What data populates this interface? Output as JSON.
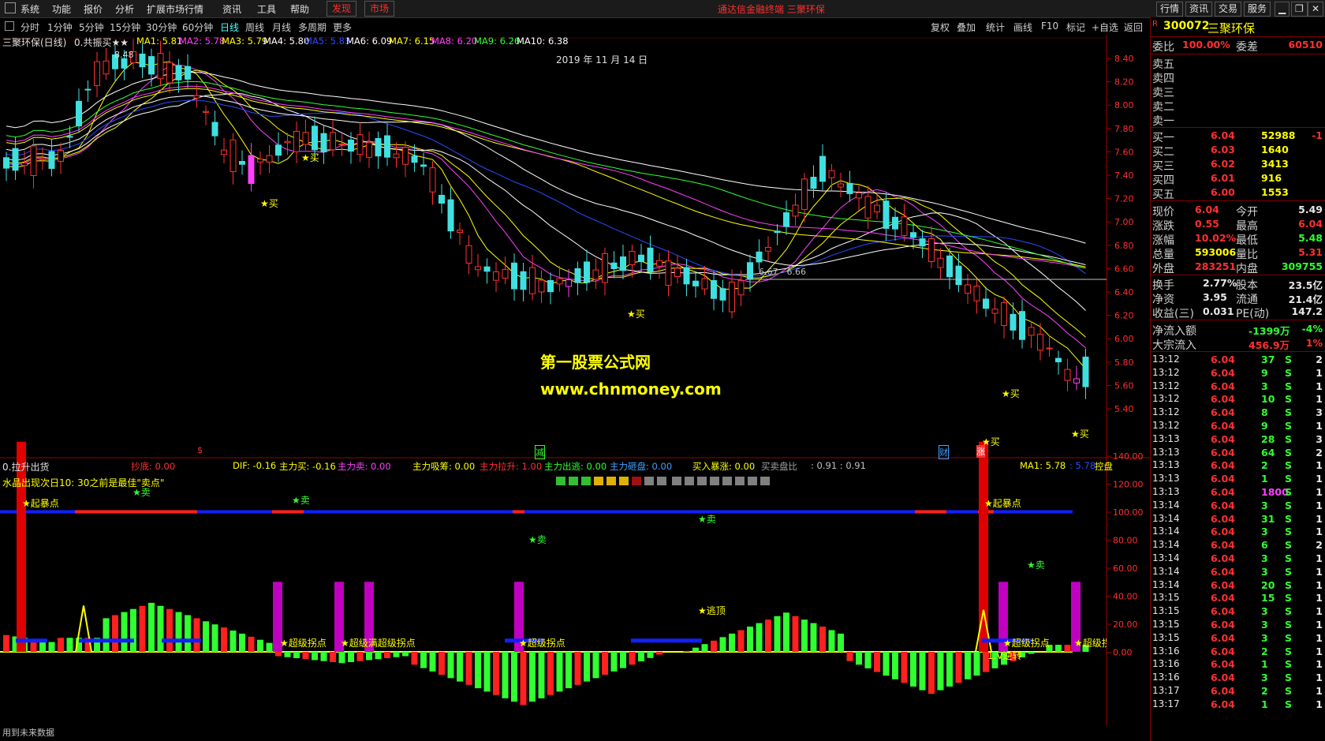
{
  "menu": {
    "items": [
      "系统",
      "功能",
      "报价",
      "分析",
      "扩展市场行情",
      "资讯",
      "工具",
      "帮助"
    ],
    "highlight1": "发现",
    "highlight2": "市场",
    "app_title": "通达信金融终端  三聚环保",
    "right_buttons": [
      "行情",
      "资讯",
      "交易",
      "服务"
    ]
  },
  "periods": {
    "items": [
      "分时",
      "1分钟",
      "5分钟",
      "15分钟",
      "30分钟",
      "60分钟",
      "日线",
      "周线",
      "月线",
      "多周期",
      "更多"
    ],
    "active": "日线"
  },
  "toolbar": {
    "buttons": [
      "复权",
      "叠加",
      "统计",
      "画线",
      "F10",
      "标记",
      "+自选",
      "返回"
    ]
  },
  "upper_chart": {
    "title": "三聚环保(日线)",
    "indicator": "0.共振买★★",
    "ma": [
      {
        "label": "MA1: 5.81",
        "color": "#ffff00"
      },
      {
        "label": "MA2: 5.78",
        "color": "#ff40ff"
      },
      {
        "label": "MA3: 5.79",
        "color": "#ffff00"
      },
      {
        "label": "MA4: 5.80",
        "color": "#ffffff"
      },
      {
        "label": "MA5: 5.83",
        "color": "#2a4bff"
      },
      {
        "label": "MA6: 6.09",
        "color": "#ffffff"
      },
      {
        "label": "MA7: 6.15",
        "color": "#ffff00"
      },
      {
        "label": "MA8: 6.20",
        "color": "#ff40ff"
      },
      {
        "label": "MA9: 6.26",
        "color": "#30ff30"
      },
      {
        "label": "MA10: 6.38",
        "color": "#ffffff"
      }
    ],
    "date_label": "2019 年 11 月 14 日",
    "high_label": "8.48",
    "ref_label": "6.67 - 6.66",
    "y_ticks": [
      "8.40",
      "8.20",
      "8.00",
      "7.80",
      "7.60",
      "7.40",
      "7.20",
      "7.00",
      "6.80",
      "6.60",
      "6.40",
      "6.20",
      "6.00",
      "5.80",
      "5.60",
      "5.40"
    ],
    "buy_marks": [
      "★买",
      "★买",
      "★买",
      "★买",
      "★买",
      "★买"
    ],
    "watermark1": "第一股票公式网",
    "watermark2": "www.chnmoney.com",
    "event_marks": [
      "$",
      "减",
      "财",
      "涨"
    ]
  },
  "lower_chart": {
    "title": "0.拉升出货",
    "stats": [
      {
        "label": "抄底: 0.00",
        "color": "#ff3030"
      },
      {
        "label": "DIF: -0.16",
        "color": "#ffff00"
      },
      {
        "label": "主力买: -0.16",
        "color": "#ffff00"
      },
      {
        "label": "主力卖: 0.00",
        "color": "#ff40ff"
      },
      {
        "label": "主力吸筹: 0.00",
        "color": "#ffff00"
      },
      {
        "label": "主力拉升: 1.00",
        "color": "#ff3030"
      },
      {
        "label": "主力出逃: 0.00",
        "color": "#30ff30"
      },
      {
        "label": "主力砸盘: 0.00",
        "color": "#40a0ff"
      },
      {
        "label": "买入暴涨: 0.00",
        "color": "#ffff00"
      },
      {
        "label": "买卖盘比",
        "color": "#a0a0a0"
      },
      {
        "label": ": 0.91  : 0.91",
        "color": "#c0c0c0"
      },
      {
        "label": "MA1: 5.78",
        "color": "#ffff00"
      },
      {
        "label": ": 5.78",
        "color": "#2a4bff"
      },
      {
        "label": "控盘",
        "color": "#ffff00"
      }
    ],
    "subtitle": "水晶出现次日10: 30之前是最佳\"卖点\"",
    "y_ticks": [
      "140.00",
      "120.00",
      "100.00",
      "80.00",
      "60.00",
      "40.00",
      "20.00",
      "0.00"
    ],
    "labels": {
      "qibao": "★起暴点",
      "sell": "★卖",
      "chaoji": "★超级拐点",
      "chaoji_combo": "★超级满超级拐点",
      "escape": "★逃顶",
      "reverse": "1.V逆转"
    }
  },
  "right_panel": {
    "stock_code": "300072",
    "stock_name": "三聚环保",
    "badge": "R\n300",
    "weibi_label": "委比",
    "weibi_value": "100.00%",
    "weicha_label": "委差",
    "weicha_value": "60510",
    "sell_labels": [
      "卖五",
      "卖四",
      "卖三",
      "卖二",
      "卖一"
    ],
    "buy_book": [
      {
        "label": "买一",
        "price": "6.04",
        "vol": "52988",
        "chg": "-1"
      },
      {
        "label": "买二",
        "price": "6.03",
        "vol": "1640",
        "chg": ""
      },
      {
        "label": "买三",
        "price": "6.02",
        "vol": "3413",
        "chg": ""
      },
      {
        "label": "买四",
        "price": "6.01",
        "vol": "916",
        "chg": ""
      },
      {
        "label": "买五",
        "price": "6.00",
        "vol": "1553",
        "chg": ""
      }
    ],
    "quote": [
      {
        "l1": "现价",
        "v1": "6.04",
        "c1": "red",
        "l2": "今开",
        "v2": "5.49",
        "c2": "wht"
      },
      {
        "l1": "涨跌",
        "v1": "0.55",
        "c1": "red",
        "l2": "最高",
        "v2": "6.04",
        "c2": "red"
      },
      {
        "l1": "涨幅",
        "v1": "10.02%",
        "c1": "red",
        "l2": "最低",
        "v2": "5.48",
        "c2": "grn"
      },
      {
        "l1": "总量",
        "v1": "593006",
        "c1": "yel",
        "l2": "量比",
        "v2": "5.31",
        "c2": "red"
      },
      {
        "l1": "外盘",
        "v1": "283251",
        "c1": "red",
        "l2": "内盘",
        "v2": "309755",
        "c2": "grn"
      }
    ],
    "fundamentals": [
      {
        "l1": "换手",
        "v1": "2.77%",
        "l2": "股本",
        "v2": "23.5亿"
      },
      {
        "l1": "净资",
        "v1": "3.95",
        "l2": "流通",
        "v2": "21.4亿"
      },
      {
        "l1": "收益(三)",
        "v1": "0.031",
        "l2": "PE(动)",
        "v2": "147.2"
      }
    ],
    "flows": [
      {
        "label": "净流入额",
        "value": "-1399万",
        "pct": "-4%",
        "color": "grn"
      },
      {
        "label": "大宗流入",
        "value": "456.9万",
        "pct": "1%",
        "color": "red"
      }
    ],
    "ticks": [
      {
        "t": "13:12",
        "p": "6.04",
        "v": "37",
        "s": "S",
        "n": "2"
      },
      {
        "t": "13:12",
        "p": "6.04",
        "v": "9",
        "s": "S",
        "n": "1"
      },
      {
        "t": "13:12",
        "p": "6.04",
        "v": "3",
        "s": "S",
        "n": "1"
      },
      {
        "t": "13:12",
        "p": "6.04",
        "v": "10",
        "s": "S",
        "n": "1"
      },
      {
        "t": "13:12",
        "p": "6.04",
        "v": "8",
        "s": "S",
        "n": "3"
      },
      {
        "t": "13:12",
        "p": "6.04",
        "v": "9",
        "s": "S",
        "n": "1"
      },
      {
        "t": "13:13",
        "p": "6.04",
        "v": "28",
        "s": "S",
        "n": "3"
      },
      {
        "t": "13:13",
        "p": "6.04",
        "v": "64",
        "s": "S",
        "n": "2"
      },
      {
        "t": "13:13",
        "p": "6.04",
        "v": "2",
        "s": "S",
        "n": "1"
      },
      {
        "t": "13:13",
        "p": "6.04",
        "v": "1",
        "s": "S",
        "n": "1"
      },
      {
        "t": "13:13",
        "p": "6.04",
        "v": "1800",
        "s": "S",
        "n": "1"
      },
      {
        "t": "13:14",
        "p": "6.04",
        "v": "3",
        "s": "S",
        "n": "1"
      },
      {
        "t": "13:14",
        "p": "6.04",
        "v": "31",
        "s": "S",
        "n": "1"
      },
      {
        "t": "13:14",
        "p": "6.04",
        "v": "3",
        "s": "S",
        "n": "1"
      },
      {
        "t": "13:14",
        "p": "6.04",
        "v": "6",
        "s": "S",
        "n": "2"
      },
      {
        "t": "13:14",
        "p": "6.04",
        "v": "3",
        "s": "S",
        "n": "1"
      },
      {
        "t": "13:14",
        "p": "6.04",
        "v": "3",
        "s": "S",
        "n": "1"
      },
      {
        "t": "13:14",
        "p": "6.04",
        "v": "20",
        "s": "S",
        "n": "1"
      },
      {
        "t": "13:15",
        "p": "6.04",
        "v": "15",
        "s": "S",
        "n": "1"
      },
      {
        "t": "13:15",
        "p": "6.04",
        "v": "3",
        "s": "S",
        "n": "1"
      },
      {
        "t": "13:15",
        "p": "6.04",
        "v": "3",
        "s": "S",
        "n": "1"
      },
      {
        "t": "13:15",
        "p": "6.04",
        "v": "3",
        "s": "S",
        "n": "1"
      },
      {
        "t": "13:16",
        "p": "6.04",
        "v": "2",
        "s": "S",
        "n": "1"
      },
      {
        "t": "13:16",
        "p": "6.04",
        "v": "1",
        "s": "S",
        "n": "1"
      },
      {
        "t": "13:16",
        "p": "6.04",
        "v": "3",
        "s": "S",
        "n": "1"
      },
      {
        "t": "13:17",
        "p": "6.04",
        "v": "2",
        "s": "S",
        "n": "1"
      },
      {
        "t": "13:17",
        "p": "6.04",
        "v": "1",
        "s": "S",
        "n": "1"
      }
    ]
  },
  "footer": {
    "text": "用到未来数据"
  }
}
